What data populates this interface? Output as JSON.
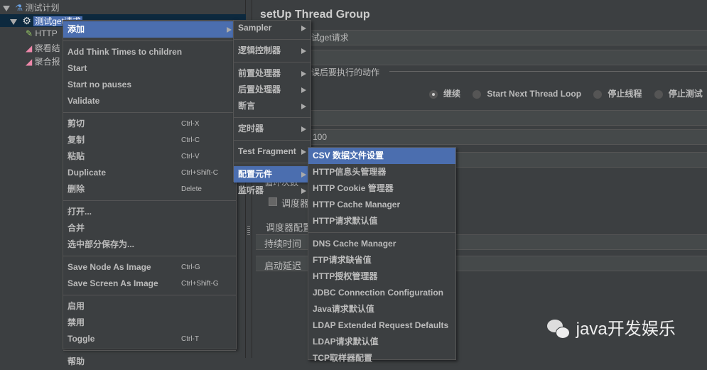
{
  "tree": {
    "root": "测试计划",
    "selected": "测试get请求",
    "children": [
      "HTTP",
      "察看结",
      "聚合报"
    ]
  },
  "panel": {
    "title": "setUp Thread Group",
    "name_value": "试get请求",
    "error_action_label": "误后要执行的动作",
    "radios": [
      {
        "label": "继续",
        "checked": true
      },
      {
        "label": "Start Next Thread Loop",
        "checked": false
      },
      {
        "label": "停止线程",
        "checked": false
      },
      {
        "label": "停止测试",
        "checked": false
      }
    ],
    "ramp_value": "100",
    "loop_label": "循环次数",
    "scheduler_checkbox": "调度器",
    "scheduler_config": "调度器配置",
    "duration_label": "持续时间（",
    "delay_label": "启动延迟（"
  },
  "context_menu": {
    "items": [
      {
        "label": "添加",
        "submenu": true,
        "selected": true
      },
      {
        "sep": true
      },
      {
        "label": "Add Think Times to children"
      },
      {
        "label": "Start"
      },
      {
        "label": "Start no pauses"
      },
      {
        "label": "Validate"
      },
      {
        "sep": true
      },
      {
        "label": "剪切",
        "shortcut": "Ctrl-X"
      },
      {
        "label": "复制",
        "shortcut": "Ctrl-C"
      },
      {
        "label": "粘贴",
        "shortcut": "Ctrl-V"
      },
      {
        "label": "Duplicate",
        "shortcut": "Ctrl+Shift-C"
      },
      {
        "label": "删除",
        "shortcut": "Delete"
      },
      {
        "sep": true
      },
      {
        "label": "打开..."
      },
      {
        "label": "合并"
      },
      {
        "label": "选中部分保存为..."
      },
      {
        "sep": true
      },
      {
        "label": "Save Node As Image",
        "shortcut": "Ctrl-G"
      },
      {
        "label": "Save Screen As Image",
        "shortcut": "Ctrl+Shift-G"
      },
      {
        "sep": true
      },
      {
        "label": "启用"
      },
      {
        "label": "禁用"
      },
      {
        "label": "Toggle",
        "shortcut": "Ctrl-T"
      },
      {
        "sep": true
      },
      {
        "label": "帮助"
      }
    ]
  },
  "add_submenu": {
    "items": [
      {
        "label": "Sampler",
        "submenu": true
      },
      {
        "sep": true
      },
      {
        "label": "逻辑控制器",
        "submenu": true
      },
      {
        "sep": true
      },
      {
        "label": "前置处理器",
        "submenu": true
      },
      {
        "label": "后置处理器",
        "submenu": true
      },
      {
        "label": "断言",
        "submenu": true
      },
      {
        "sep": true
      },
      {
        "label": "定时器",
        "submenu": true
      },
      {
        "sep": true
      },
      {
        "label": "Test Fragment",
        "submenu": true
      },
      {
        "sep": true
      },
      {
        "label": "配置元件",
        "submenu": true,
        "selected": true
      },
      {
        "label": "监听器",
        "submenu": true
      }
    ]
  },
  "config_submenu": {
    "items": [
      {
        "label": "CSV 数据文件设置",
        "selected": true
      },
      {
        "label": "HTTP信息头管理器"
      },
      {
        "label": "HTTP Cookie 管理器"
      },
      {
        "label": "HTTP Cache Manager"
      },
      {
        "label": "HTTP请求默认值"
      },
      {
        "sep": true
      },
      {
        "label": "DNS Cache Manager"
      },
      {
        "label": "FTP请求缺省值"
      },
      {
        "label": "HTTP授权管理器"
      },
      {
        "label": "JDBC Connection Configuration"
      },
      {
        "label": "Java请求默认值"
      },
      {
        "label": "LDAP Extended Request Defaults"
      },
      {
        "label": "LDAP请求默认值"
      },
      {
        "label": "TCP取样器配置"
      }
    ]
  },
  "watermark": {
    "text": "java开发娱乐",
    "icon": "wechat-icon"
  },
  "colors": {
    "selection": "#4b6eaf",
    "background": "#3c3f41",
    "text": "#bbbbbb"
  }
}
